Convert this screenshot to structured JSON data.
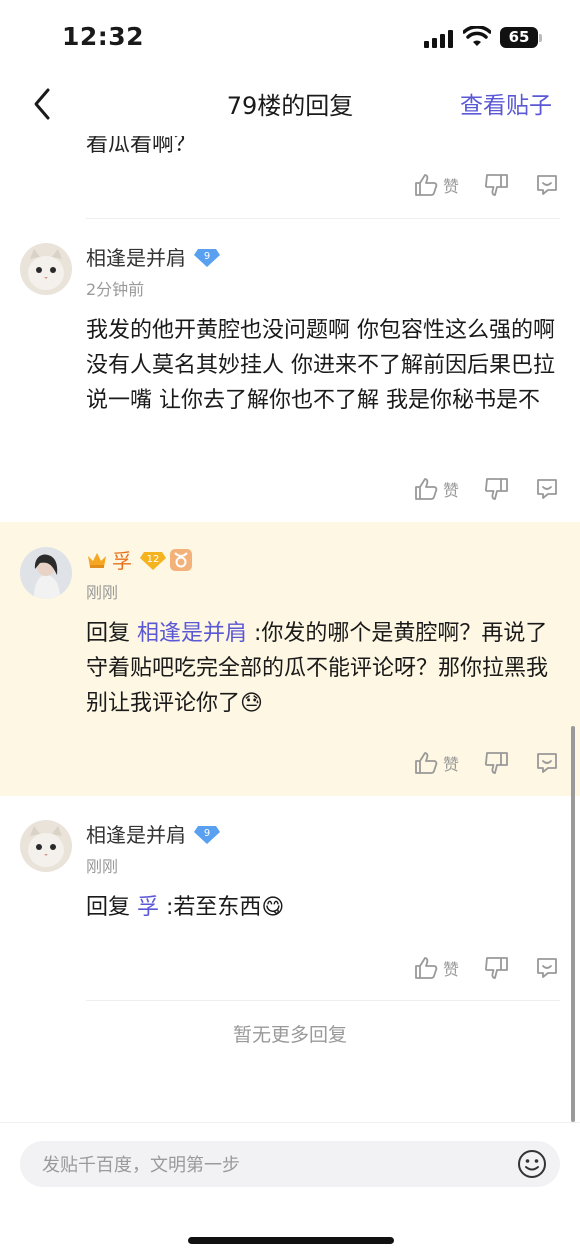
{
  "status_bar": {
    "time": "12:32",
    "battery": "65"
  },
  "nav": {
    "title": "79楼的回复",
    "view_post": "查看贴子"
  },
  "clipped_text": "看瓜看啊？",
  "actions": {
    "like": "赞"
  },
  "replies": [
    {
      "username": "相逢是并肩",
      "level": "9",
      "time": "2分钟前",
      "text": "我发的他开黄腔也没问题啊 你包容性这么强的啊 没有人莫名其妙挂人 你进来不了解前因后果巴拉说一嘴 让你去了解你也不了解 我是你秘书是不"
    },
    {
      "username": "孚",
      "level": "12",
      "time": "刚刚",
      "reply_prefix": "回复 ",
      "reply_to": "相逢是并肩",
      "text": " :你发的哪个是黄腔啊？再说了守着贴吧吃完全部的瓜不能评论呀？那你拉黑我别让我评论你了",
      "emoji": "😓"
    },
    {
      "username": "相逢是并肩",
      "level": "9",
      "time": "刚刚",
      "reply_prefix": "回复 ",
      "reply_to": "孚",
      "text": " :若至东西",
      "emoji": "😋"
    }
  ],
  "footer": {
    "no_more": "暂无更多回复"
  },
  "input": {
    "placeholder": "发贴千百度，文明第一步"
  }
}
